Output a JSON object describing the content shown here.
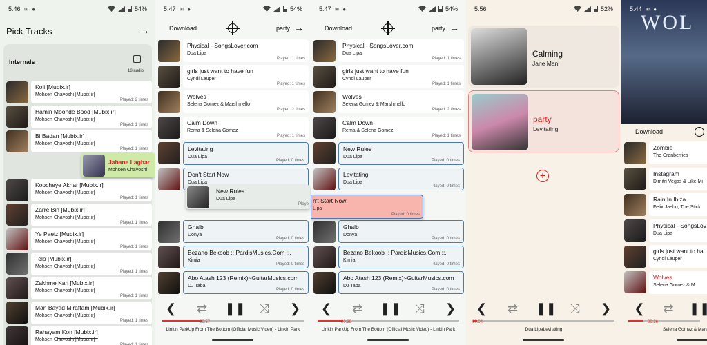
{
  "s1": {
    "time": "5:46",
    "battery": "54%",
    "title": "Pick Tracks",
    "section": "Internals",
    "count": "18 audio",
    "tracks": [
      {
        "title": "Koli [Mubix.ir]",
        "artist": "Mohsen Chavoshi [Mubix.ir]",
        "played": "Played: 2 times"
      },
      {
        "title": "Hamin Moonde Bood [Mubix.ir]",
        "artist": "Mohsen Chavoshi [Mubix.ir]",
        "played": "Played: 1 times"
      },
      {
        "title": "Bi Badan [Mubix.ir]",
        "artist": "Mohsen Chavoshi [Mubix.ir]",
        "played": "Played: 1 times"
      },
      {
        "title": "Koocheye Akhar [Mubix.ir]",
        "artist": "Mohsen Chavoshi [Mubix.ir]",
        "played": "Played: 1 times"
      },
      {
        "title": "Zarre Bin [Mubix.ir]",
        "artist": "Mohsen Chavoshi [Mubix.ir]",
        "played": "Played: 1 times"
      },
      {
        "title": "Ye Paeiz [Mubix.ir]",
        "artist": "Mohsen Chavoshi [Mubix.ir]",
        "played": "Played: 1 times"
      },
      {
        "title": "Telo [Mubix.ir]",
        "artist": "Mohsen Chavoshi [Mubix.ir]",
        "played": "Played: 1 times"
      },
      {
        "title": "Zakhme Kari [Mubix.ir]",
        "artist": "Mohsen Chavoshi [Mubix.ir]",
        "played": "Played: 1 times"
      },
      {
        "title": "Man Bayad Miraftam [Mubix.ir]",
        "artist": "Mohsen Chavoshi [Mubix.ir]",
        "played": "Played: 1 times"
      },
      {
        "title": "Rahayam Kon [Mubix.ir]",
        "artist": "Mohsen Chavoshi [Mubix.ir]",
        "played": "Played: 1 times"
      }
    ],
    "drag": {
      "title": "Jahane Laghar",
      "artist": "Mohsen Chavoshi"
    }
  },
  "s2": {
    "time": "5:47",
    "battery": "54%",
    "download": "Download",
    "playlist": "party",
    "tracks": [
      {
        "title": "Physical - SongsLover.com",
        "artist": "Dua Lipa",
        "played": "Played: 1 times"
      },
      {
        "title": "girls just want to have fun",
        "artist": "Cyndi Lauper",
        "played": "Played: 1 times"
      },
      {
        "title": "Wolves",
        "artist": "Selena Gomez & Marshmello",
        "played": "Played: 2 times"
      },
      {
        "title": "Calm Down",
        "artist": "Rema & Selena Gomez",
        "played": "Played: 1 times"
      },
      {
        "title": "Levitating",
        "artist": "Dua Lipa",
        "played": "Played: 0 times"
      },
      {
        "title": "Don't Start Now",
        "artist": "Dua Lipa",
        "played": ""
      },
      {
        "title": "Ghalb",
        "artist": "Donya",
        "played": "Played: 0 times"
      },
      {
        "title": "Bezano Bekoob  :: PardisMusics.Com ::.",
        "artist": "Kimia",
        "played": "Played: 0 times"
      },
      {
        "title": "Abo Atash 123 (Remix)~GuitarMusics.com",
        "artist": "DJ Taba",
        "played": "Played: 0 times"
      }
    ],
    "drag": {
      "title": "New Rules",
      "artist": "Dua Lipa",
      "played": "Playe"
    },
    "elapsed": "00:57",
    "now": "Linkin ParkUp From The Bottom (Official Music Video) - Linkin Park"
  },
  "s3": {
    "time": "5:47",
    "battery": "54%",
    "download": "Download",
    "playlist": "party",
    "tracks": [
      {
        "title": "Physical - SongsLover.com",
        "artist": "Dua Lipa",
        "played": "Played: 1 times"
      },
      {
        "title": "girls just want to have fun",
        "artist": "Cyndi Lauper",
        "played": "Played: 1 times"
      },
      {
        "title": "Wolves",
        "artist": "Selena Gomez & Marshmello",
        "played": "Played: 2 times"
      },
      {
        "title": "Calm Down",
        "artist": "Rema & Selena Gomez",
        "played": "Played: 1 times"
      },
      {
        "title": "New Rules",
        "artist": "Dua Lipa",
        "played": "Played: 0 times"
      },
      {
        "title": "Levitating",
        "artist": "Dua Lipa",
        "played": "Played: 0 times"
      },
      {
        "title": "Ghalb",
        "artist": "Donya",
        "played": "Played: 0 times"
      },
      {
        "title": "Bezano Bekoob  :: PardisMusics.Com ::.",
        "artist": "Kimia",
        "played": "Played: 0 times"
      },
      {
        "title": "Abo Atash 123 (Remix)~GuitarMusics.com",
        "artist": "DJ Taba",
        "played": "Played: 0 times"
      }
    ],
    "drag": {
      "title": "n't Start Now",
      "artist": "Lipa",
      "played": "Played: 0 times"
    },
    "elapsed": "00:39",
    "now": "Linkin ParkUp From The Bottom (Official Music Video) - Linkin Park"
  },
  "s4": {
    "time": "5:56",
    "battery": "52%",
    "playlists": [
      {
        "name": "Calming",
        "sub": "Jane Mani"
      },
      {
        "name": "party",
        "sub": "Levitating"
      }
    ],
    "elapsed": "00:04",
    "now": "Dua LipaLevitating"
  },
  "s5": {
    "time": "5:44",
    "banner": "WOL",
    "download": "Download",
    "tracks": [
      {
        "title": "Zombie",
        "artist": "The Cranberries"
      },
      {
        "title": "Instagram",
        "artist": "Dimitri Vegas & Like Mi"
      },
      {
        "title": "Rain In Ibiza",
        "artist": "Felix Jaehn, The Stick"
      },
      {
        "title": "Physical - SongsLov",
        "artist": "Dua Lipa"
      },
      {
        "title": "girls just want to ha",
        "artist": "Cyndi Lauper"
      },
      {
        "title": "Wolves",
        "artist": "Selena Gomez & M"
      }
    ],
    "elapsed": "00:36",
    "now": "Selena Gomez & Marshm"
  },
  "controls": {
    "prev": "❮",
    "repeat": "⇄",
    "pause": "❚❚",
    "shuffle": "⤨",
    "next": "❯"
  },
  "colors": {
    "accent": "#d22222",
    "selected_border": "#4a78b8",
    "drag_green": "#cfe9a8",
    "drag_red": "#f7b5ae"
  }
}
